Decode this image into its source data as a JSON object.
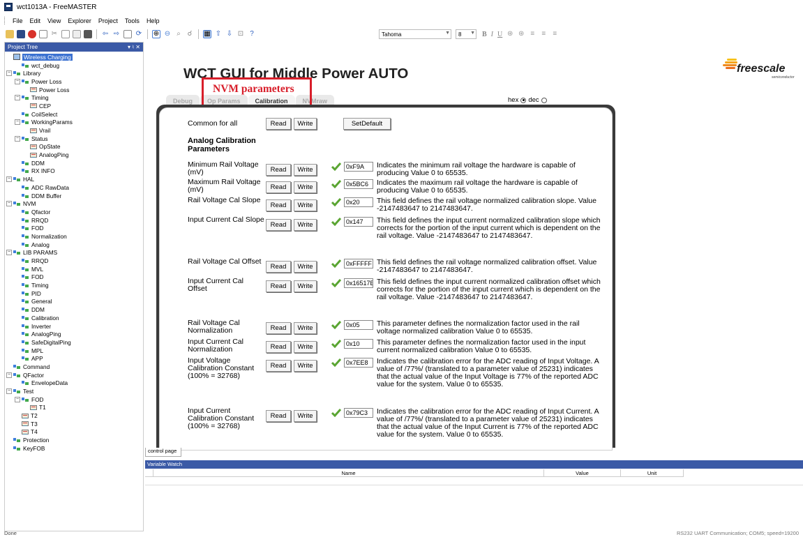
{
  "window": {
    "title": "wct1013A - FreeMASTER"
  },
  "menubar": {
    "items": [
      "File",
      "Edit",
      "View",
      "Explorer",
      "Project",
      "Tools",
      "Help"
    ]
  },
  "toolbar": {
    "font": "Tahoma",
    "size": "8",
    "format_buttons": [
      "B",
      "I",
      "U"
    ]
  },
  "project_tree": {
    "header": "Project Tree",
    "header_controls": "▾ ♮ ✕",
    "items": [
      {
        "label": "Wireless Charging",
        "level": 0,
        "icon": "root",
        "exp": "",
        "selected": true
      },
      {
        "label": "wct_debug",
        "level": 1,
        "icon": "folder",
        "exp": ""
      },
      {
        "label": "Library",
        "level": 0,
        "icon": "folder",
        "exp": "−"
      },
      {
        "label": "Power Loss",
        "level": 1,
        "icon": "folder",
        "exp": "−"
      },
      {
        "label": "Power Loss",
        "level": 2,
        "icon": "screen",
        "exp": ""
      },
      {
        "label": "Timing",
        "level": 1,
        "icon": "folder",
        "exp": "−"
      },
      {
        "label": "CEP",
        "level": 2,
        "icon": "screen",
        "exp": ""
      },
      {
        "label": "CoilSelect",
        "level": 1,
        "icon": "folder",
        "exp": ""
      },
      {
        "label": "WorkingParams",
        "level": 1,
        "icon": "folder",
        "exp": "−"
      },
      {
        "label": "Vrail",
        "level": 2,
        "icon": "screen",
        "exp": ""
      },
      {
        "label": "Status",
        "level": 1,
        "icon": "folder",
        "exp": "−"
      },
      {
        "label": "OpState",
        "level": 2,
        "icon": "screen",
        "exp": ""
      },
      {
        "label": "AnalogPing",
        "level": 2,
        "icon": "screen",
        "exp": ""
      },
      {
        "label": "DDM",
        "level": 1,
        "icon": "folder",
        "exp": ""
      },
      {
        "label": "RX INFO",
        "level": 1,
        "icon": "folder",
        "exp": ""
      },
      {
        "label": "HAL",
        "level": 0,
        "icon": "folder",
        "exp": "−"
      },
      {
        "label": "ADC RawData",
        "level": 1,
        "icon": "folder",
        "exp": ""
      },
      {
        "label": "DDM Buffer",
        "level": 1,
        "icon": "folder",
        "exp": ""
      },
      {
        "label": "NVM",
        "level": 0,
        "icon": "folder",
        "exp": "−"
      },
      {
        "label": "Qfactor",
        "level": 1,
        "icon": "folder",
        "exp": ""
      },
      {
        "label": "RRQD",
        "level": 1,
        "icon": "folder",
        "exp": ""
      },
      {
        "label": "FOD",
        "level": 1,
        "icon": "folder",
        "exp": ""
      },
      {
        "label": "Normalization",
        "level": 1,
        "icon": "folder",
        "exp": ""
      },
      {
        "label": "Analog",
        "level": 1,
        "icon": "folder",
        "exp": ""
      },
      {
        "label": "LIB PARAMS",
        "level": 0,
        "icon": "folder",
        "exp": "−"
      },
      {
        "label": "RRQD",
        "level": 1,
        "icon": "folder",
        "exp": ""
      },
      {
        "label": "MVL",
        "level": 1,
        "icon": "folder",
        "exp": ""
      },
      {
        "label": "FOD",
        "level": 1,
        "icon": "folder",
        "exp": ""
      },
      {
        "label": "Timing",
        "level": 1,
        "icon": "folder",
        "exp": ""
      },
      {
        "label": "PID",
        "level": 1,
        "icon": "folder",
        "exp": ""
      },
      {
        "label": "General",
        "level": 1,
        "icon": "folder",
        "exp": ""
      },
      {
        "label": "DDM",
        "level": 1,
        "icon": "folder",
        "exp": ""
      },
      {
        "label": "Calibration",
        "level": 1,
        "icon": "folder",
        "exp": ""
      },
      {
        "label": "Inverter",
        "level": 1,
        "icon": "folder",
        "exp": ""
      },
      {
        "label": "AnalogPing",
        "level": 1,
        "icon": "folder",
        "exp": ""
      },
      {
        "label": "SafeDigitalPing",
        "level": 1,
        "icon": "folder",
        "exp": ""
      },
      {
        "label": "MPL",
        "level": 1,
        "icon": "folder",
        "exp": ""
      },
      {
        "label": "APP",
        "level": 1,
        "icon": "folder",
        "exp": ""
      },
      {
        "label": "Command",
        "level": 0,
        "icon": "folder",
        "exp": ""
      },
      {
        "label": "QFactor",
        "level": 0,
        "icon": "folder",
        "exp": "−"
      },
      {
        "label": "EnvelopeData",
        "level": 1,
        "icon": "folder",
        "exp": ""
      },
      {
        "label": "Test",
        "level": 0,
        "icon": "folder",
        "exp": "−"
      },
      {
        "label": "FOD",
        "level": 1,
        "icon": "folder",
        "exp": "−"
      },
      {
        "label": "T1",
        "level": 2,
        "icon": "screen",
        "exp": ""
      },
      {
        "label": "T2",
        "level": 1,
        "icon": "screen",
        "exp": ""
      },
      {
        "label": "T3",
        "level": 1,
        "icon": "screen",
        "exp": ""
      },
      {
        "label": "T4",
        "level": 1,
        "icon": "screen",
        "exp": ""
      },
      {
        "label": "Protection",
        "level": 0,
        "icon": "folder",
        "exp": ""
      },
      {
        "label": "KeyFOB",
        "level": 0,
        "icon": "folder",
        "exp": ""
      }
    ]
  },
  "main": {
    "title": "WCT GUI for Middle Power AUTO",
    "logo": {
      "word": "freescale",
      "sub": "semiconductor"
    },
    "annotation": "NVM parameters",
    "tabs": [
      {
        "label": "Debug",
        "active": false
      },
      {
        "label": "Op Params",
        "active": false
      },
      {
        "label": "Calibration",
        "active": true
      },
      {
        "label": "NVMraw",
        "active": false
      }
    ],
    "radix": {
      "hex": "hex",
      "dec": "dec",
      "selected": "hex"
    },
    "common_label": "Common for all",
    "read_label": "Read",
    "write_label": "Write",
    "setdefault_label": "SetDefault",
    "section_title": "Analog Calibration Parameters",
    "params": [
      {
        "name": "Minimum Rail Voltage (mV)",
        "value": "0xF9A",
        "desc": "Indicates the minimum rail voltage the hardware is capable of producing Value 0 to 65535."
      },
      {
        "name": "Maximum Rail Voltage (mV)",
        "value": "0x5BC6",
        "desc": "Indicates the maximum rail voltage the hardware is capable of producing Value 0 to 65535."
      },
      {
        "name": "Rail Voltage Cal Slope",
        "value": "0x20",
        "desc": "This field defines the rail voltage normalized calibration slope. Value -2147483647 to 2147483647."
      },
      {
        "name": "Input Current Cal Slope",
        "value": "0x147",
        "desc": "This field defines the input current normalized calibration slope which corrects for the portion of the input current which is dependent on the rail voltage. Value -2147483647 to 2147483647."
      },
      {
        "name": "Rail Voltage Cal Offset",
        "value": "0xFFFFF",
        "desc": "This field defines the rail voltage normalized calibration offset. Value -2147483647 to 2147483647."
      },
      {
        "name": "Input Current Cal Offset",
        "value": "0x16517E",
        "desc": "This field defines the input current normalized calibration offset which corrects for the portion of the input current which is dependent on the rail voltage. Value -2147483647 to 2147483647."
      },
      {
        "name": "Rail Voltage Cal Normalization",
        "value": "0x05",
        "desc": "This parameter defines the normalization factor used in the rail voltage normalized calibration Value 0 to 65535."
      },
      {
        "name": "Input Current Cal Normalization",
        "value": "0x10",
        "desc": "This parameter defines the normalization factor used in the input current normalized calibration Value 0 to 65535."
      },
      {
        "name": "Input Voltage Calibration Constant (100% = 32768)",
        "value": "0x7EE8",
        "desc": "Indicates the calibration error for the ADC reading of Input Voltage. A value of /77%/ (translated to a parameter value of 25231) indicates that the actual value of the Input Voltage is 77% of the reported ADC value for the system. Value 0 to 65535."
      },
      {
        "name": "Input Current Calibration Constant (100% = 32768)",
        "value": "0x79C3",
        "desc": "Indicates the calibration error for the ADC reading of Input Current. A value of /77%/ (translated to a parameter value of 25231) indicates that the actual value of the Input Current is 77% of the reported ADC value for the system. Value 0 to 65535."
      }
    ]
  },
  "bottom": {
    "control_tab": "control page",
    "watch_header": "Variable Watch",
    "columns": [
      "Name",
      "Value",
      "Unit"
    ]
  },
  "status": {
    "left": "Done",
    "right": "RS232 UART Communication; COM5; speed=19200"
  }
}
